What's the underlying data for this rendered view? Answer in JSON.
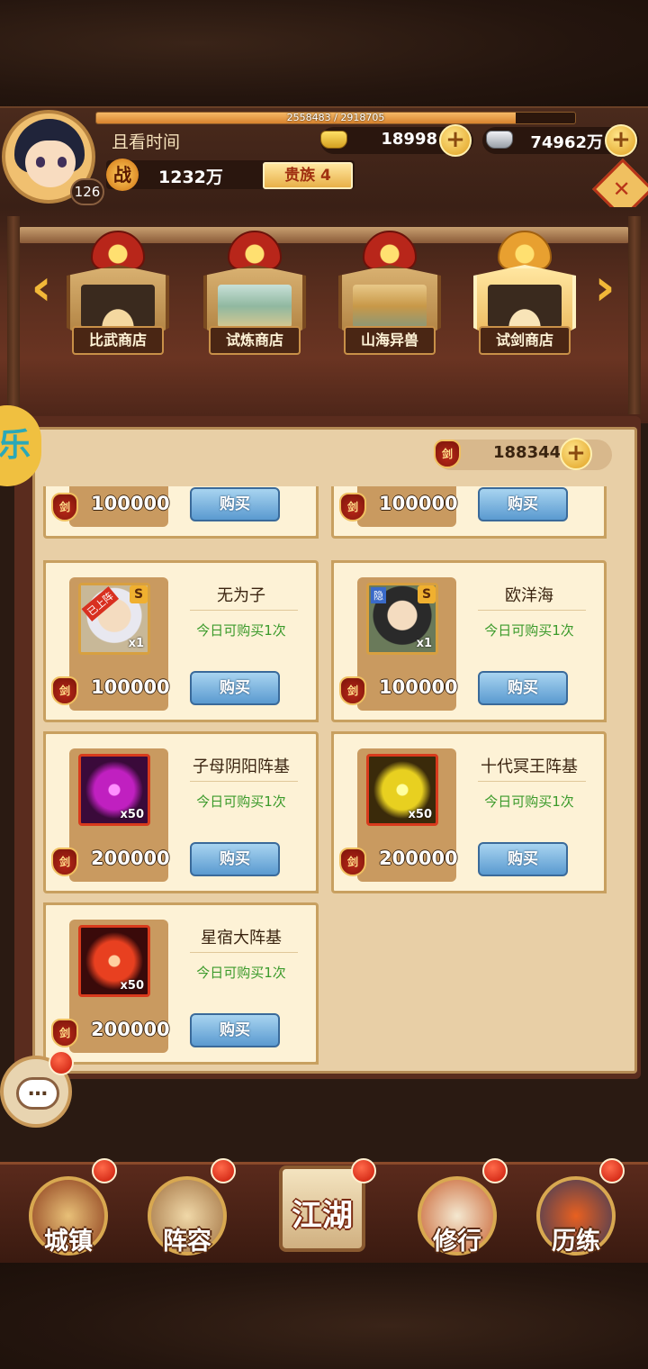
{
  "player": {
    "name": "且看时间",
    "level": "126",
    "exp_text": "2558483 / 2918705",
    "exp_fraction": 0.8766,
    "power_icon": "战",
    "power": "1232万",
    "noble": "贵族 4"
  },
  "currencies": {
    "gold": "18998",
    "silver": "74962万",
    "add_symbol": "+"
  },
  "shop_tabs": [
    {
      "label": "比武商店",
      "active": false
    },
    {
      "label": "试炼商店",
      "active": false
    },
    {
      "label": "山海异兽",
      "active": false
    },
    {
      "label": "试剑商店",
      "active": true
    }
  ],
  "side_badge": "乐",
  "token_balance": "188344",
  "token_icon_char": "剑",
  "items": [
    {
      "name": "",
      "limit": "",
      "price": "100000",
      "buy": "购买",
      "qty": ""
    },
    {
      "name": "",
      "limit": "",
      "price": "100000",
      "buy": "购买",
      "qty": ""
    },
    {
      "name": "无为子",
      "limit": "今日可购买1次",
      "price": "100000",
      "buy": "购买",
      "qty": "x1",
      "tag": "已上阵",
      "grade": "S"
    },
    {
      "name": "欧洋海",
      "limit": "今日可购买1次",
      "price": "100000",
      "buy": "购买",
      "qty": "x1",
      "tag": "隐",
      "grade": "S"
    },
    {
      "name": "子母阴阳阵基",
      "limit": "今日可购买1次",
      "price": "200000",
      "buy": "购买",
      "qty": "x50"
    },
    {
      "name": "十代冥王阵基",
      "limit": "今日可购买1次",
      "price": "200000",
      "buy": "购买",
      "qty": "x50"
    },
    {
      "name": "星宿大阵基",
      "limit": "今日可购买1次",
      "price": "200000",
      "buy": "购买",
      "qty": "x50"
    }
  ],
  "nav": {
    "town": "城镇",
    "lineup": "阵容",
    "jianghu": "江湖",
    "cultivate": "修行",
    "training": "历练"
  },
  "chat_symbol": "…",
  "colors": {
    "panel": "#e8cfa6",
    "card": "#fdf2d6",
    "buy_button": "#5a9ad0",
    "limit_text": "#3a9a2a",
    "notification": "#c81808"
  }
}
